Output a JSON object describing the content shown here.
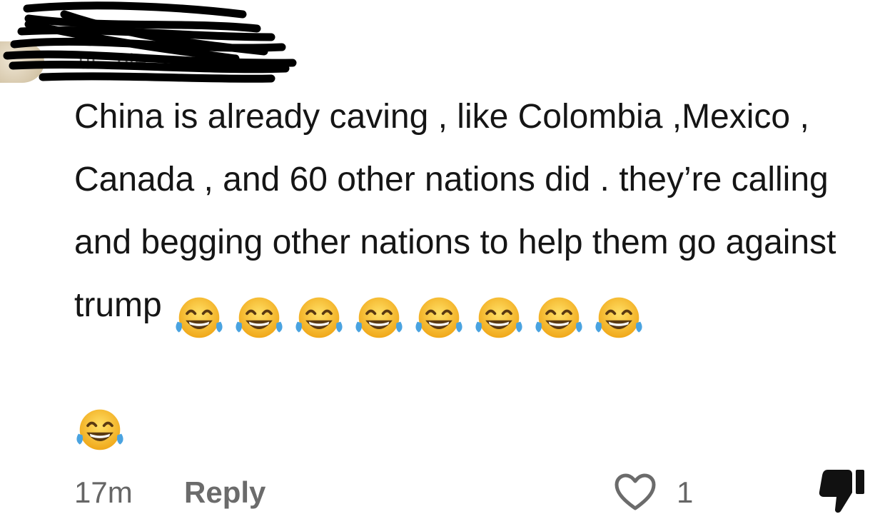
{
  "comment": {
    "username": "ul...ble",
    "text": "China is already caving , like Colombia ,Mexico , Canada , and 60 other nations did . they’re calling and begging other nations to help them go against trump",
    "emoji": "face-with-tears-of-joy",
    "emoji_count": 9,
    "timestamp": "17m",
    "reply_label": "Reply",
    "like_count": "1"
  },
  "icons": {
    "like": "heart-outline-icon",
    "dislike": "thumbs-down-icon"
  },
  "colors": {
    "text": "#151515",
    "meta": "#666666",
    "emoji_face": "#f7c331",
    "emoji_tears": "#4aa3e0"
  }
}
